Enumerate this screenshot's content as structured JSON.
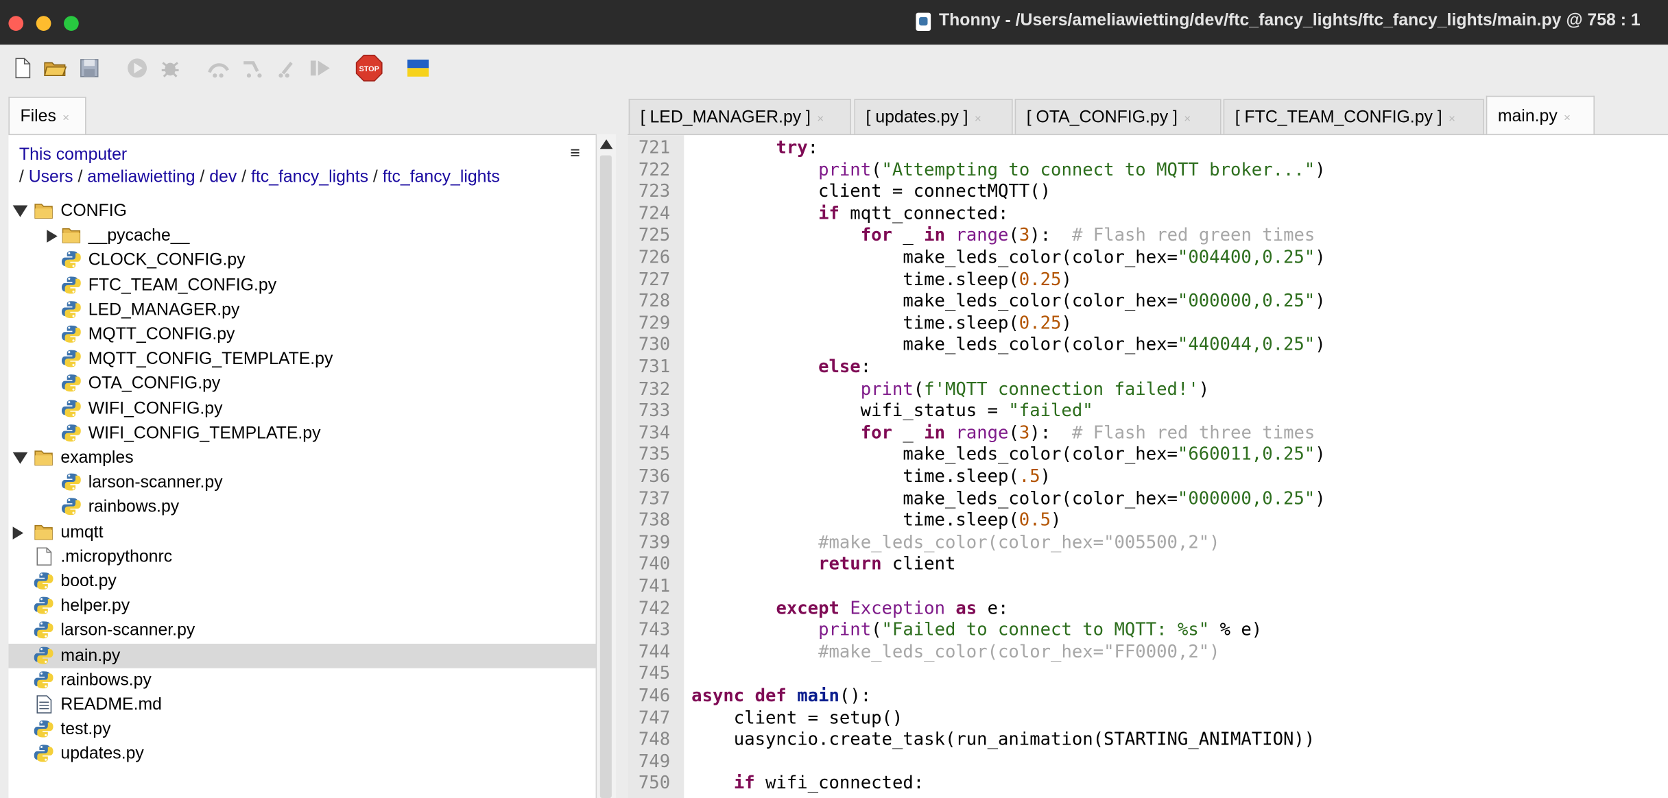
{
  "window": {
    "app_name": "Thonny",
    "title_sep": " - ",
    "path": "/Users/ameliawietting/dev/ftc_fancy_lights/ftc_fancy_lights/main.py",
    "cursor": "@ 758 : 1"
  },
  "toolbar": {
    "buttons": [
      "new-file",
      "open-file",
      "save-file",
      "run",
      "debug",
      "step-over",
      "step-into",
      "step-out",
      "resume",
      "stop",
      "flag"
    ],
    "stop_label": "STOP"
  },
  "files_panel": {
    "tab_label": "Files",
    "tab_close": "×",
    "location_label": "This computer",
    "menu_glyph": "≡",
    "breadcrumb": [
      "Users",
      "ameliawietting",
      "dev",
      "ftc_fancy_lights",
      "ftc_fancy_lights"
    ],
    "breadcrumb_sep": "/",
    "tree": [
      {
        "label": "CONFIG",
        "type": "folder",
        "state": "expanded"
      },
      {
        "label": "__pycache__",
        "type": "folder",
        "state": "collapsed"
      },
      {
        "label": "CLOCK_CONFIG.py",
        "type": "python"
      },
      {
        "label": "FTC_TEAM_CONFIG.py",
        "type": "python"
      },
      {
        "label": "LED_MANAGER.py",
        "type": "python"
      },
      {
        "label": "MQTT_CONFIG.py",
        "type": "python"
      },
      {
        "label": "MQTT_CONFIG_TEMPLATE.py",
        "type": "python"
      },
      {
        "label": "OTA_CONFIG.py",
        "type": "python"
      },
      {
        "label": "WIFI_CONFIG.py",
        "type": "python"
      },
      {
        "label": "WIFI_CONFIG_TEMPLATE.py",
        "type": "python"
      },
      {
        "label": "examples",
        "type": "folder",
        "state": "expanded"
      },
      {
        "label": "larson-scanner.py",
        "type": "python"
      },
      {
        "label": "rainbows.py",
        "type": "python"
      },
      {
        "label": "umqtt",
        "type": "folder",
        "state": "collapsed"
      },
      {
        "label": ".micropythonrc",
        "type": "file"
      },
      {
        "label": "boot.py",
        "type": "python"
      },
      {
        "label": "helper.py",
        "type": "python"
      },
      {
        "label": "larson-scanner.py",
        "type": "python"
      },
      {
        "label": "main.py",
        "type": "python",
        "selected": true
      },
      {
        "label": "rainbows.py",
        "type": "python"
      },
      {
        "label": "README.md",
        "type": "markdown"
      },
      {
        "label": "test.py",
        "type": "python"
      },
      {
        "label": "updates.py",
        "type": "python"
      }
    ]
  },
  "editor_tabs": [
    {
      "label": "[ LED_MANAGER.py ]",
      "close": "×"
    },
    {
      "label": "[ updates.py ]",
      "close": "×"
    },
    {
      "label": "[ OTA_CONFIG.py ]",
      "close": "×"
    },
    {
      "label": "[ FTC_TEAM_CONFIG.py ]",
      "close": "×"
    },
    {
      "label": "main.py",
      "close": "×",
      "active": true
    }
  ],
  "editor": {
    "lines": [
      {
        "n": "721",
        "tokens": [
          [
            "",
            "        "
          ],
          [
            "kw",
            "try"
          ],
          [
            "",
            ":"
          ]
        ]
      },
      {
        "n": "722",
        "tokens": [
          [
            "",
            "            "
          ],
          [
            "bi",
            "print"
          ],
          [
            "",
            "("
          ],
          [
            "st",
            "\"Attempting to connect to MQTT broker...\""
          ],
          [
            "",
            ")"
          ]
        ]
      },
      {
        "n": "723",
        "tokens": [
          [
            "",
            "            client = connectMQTT()"
          ]
        ]
      },
      {
        "n": "724",
        "tokens": [
          [
            "",
            "            "
          ],
          [
            "kw",
            "if"
          ],
          [
            "",
            " mqtt_connected:"
          ]
        ]
      },
      {
        "n": "725",
        "tokens": [
          [
            "",
            "                "
          ],
          [
            "kw",
            "for"
          ],
          [
            "",
            " _ "
          ],
          [
            "kw",
            "in"
          ],
          [
            "",
            " "
          ],
          [
            "bi",
            "range"
          ],
          [
            "",
            "("
          ],
          [
            "nu",
            "3"
          ],
          [
            "",
            "):  "
          ],
          [
            "cm",
            "# Flash red green times"
          ]
        ]
      },
      {
        "n": "726",
        "tokens": [
          [
            "",
            "                    make_leds_color(color_hex="
          ],
          [
            "st",
            "\"004400,0.25\""
          ],
          [
            "",
            ")"
          ]
        ]
      },
      {
        "n": "727",
        "tokens": [
          [
            "",
            "                    time.sleep("
          ],
          [
            "nu",
            "0.25"
          ],
          [
            "",
            ")"
          ]
        ]
      },
      {
        "n": "728",
        "tokens": [
          [
            "",
            "                    make_leds_color(color_hex="
          ],
          [
            "st",
            "\"000000,0.25\""
          ],
          [
            "",
            ")"
          ]
        ]
      },
      {
        "n": "729",
        "tokens": [
          [
            "",
            "                    time.sleep("
          ],
          [
            "nu",
            "0.25"
          ],
          [
            "",
            ")"
          ]
        ]
      },
      {
        "n": "730",
        "tokens": [
          [
            "",
            "                    make_leds_color(color_hex="
          ],
          [
            "st",
            "\"440044,0.25\""
          ],
          [
            "",
            ")"
          ]
        ]
      },
      {
        "n": "731",
        "tokens": [
          [
            "",
            "            "
          ],
          [
            "kw",
            "else"
          ],
          [
            "",
            ":"
          ]
        ]
      },
      {
        "n": "732",
        "tokens": [
          [
            "",
            "                "
          ],
          [
            "bi",
            "print"
          ],
          [
            "",
            "("
          ],
          [
            "st",
            "f'MQTT connection failed!'"
          ],
          [
            "",
            ")"
          ]
        ]
      },
      {
        "n": "733",
        "tokens": [
          [
            "",
            "                wifi_status = "
          ],
          [
            "st",
            "\"failed\""
          ]
        ]
      },
      {
        "n": "734",
        "tokens": [
          [
            "",
            "                "
          ],
          [
            "kw",
            "for"
          ],
          [
            "",
            " _ "
          ],
          [
            "kw",
            "in"
          ],
          [
            "",
            " "
          ],
          [
            "bi",
            "range"
          ],
          [
            "",
            "("
          ],
          [
            "nu",
            "3"
          ],
          [
            "",
            "):  "
          ],
          [
            "cm",
            "# Flash red three times"
          ]
        ]
      },
      {
        "n": "735",
        "tokens": [
          [
            "",
            "                    make_leds_color(color_hex="
          ],
          [
            "st",
            "\"660011,0.25\""
          ],
          [
            "",
            ")"
          ]
        ]
      },
      {
        "n": "736",
        "tokens": [
          [
            "",
            "                    time.sleep("
          ],
          [
            "nu",
            ".5"
          ],
          [
            "",
            ")"
          ]
        ]
      },
      {
        "n": "737",
        "tokens": [
          [
            "",
            "                    make_leds_color(color_hex="
          ],
          [
            "st",
            "\"000000,0.25\""
          ],
          [
            "",
            ")"
          ]
        ]
      },
      {
        "n": "738",
        "tokens": [
          [
            "",
            "                    time.sleep("
          ],
          [
            "nu",
            "0.5"
          ],
          [
            "",
            ")"
          ]
        ]
      },
      {
        "n": "739",
        "tokens": [
          [
            "",
            "            "
          ],
          [
            "cm",
            "#make_leds_color(color_hex=\"005500,2\")"
          ]
        ]
      },
      {
        "n": "740",
        "tokens": [
          [
            "",
            "            "
          ],
          [
            "kw",
            "return"
          ],
          [
            "",
            " client"
          ]
        ]
      },
      {
        "n": "741",
        "tokens": [
          [
            "",
            ""
          ]
        ]
      },
      {
        "n": "742",
        "tokens": [
          [
            "",
            "        "
          ],
          [
            "kw",
            "except"
          ],
          [
            "",
            " "
          ],
          [
            "bi",
            "Exception"
          ],
          [
            "",
            " "
          ],
          [
            "kw",
            "as"
          ],
          [
            "",
            " e:"
          ]
        ]
      },
      {
        "n": "743",
        "tokens": [
          [
            "",
            "            "
          ],
          [
            "bi",
            "print"
          ],
          [
            "",
            "("
          ],
          [
            "st",
            "\"Failed to connect to MQTT: %s\""
          ],
          [
            "",
            " % e)"
          ]
        ]
      },
      {
        "n": "744",
        "tokens": [
          [
            "",
            "            "
          ],
          [
            "cm",
            "#make_leds_color(color_hex=\"FF0000,2\")"
          ]
        ]
      },
      {
        "n": "745",
        "tokens": [
          [
            "",
            ""
          ]
        ]
      },
      {
        "n": "746",
        "tokens": [
          [
            "kw",
            "async"
          ],
          [
            "",
            " "
          ],
          [
            "kw",
            "def"
          ],
          [
            "",
            " "
          ],
          [
            "fn",
            "main"
          ],
          [
            "",
            "():"
          ]
        ]
      },
      {
        "n": "747",
        "tokens": [
          [
            "",
            "    client = setup()"
          ]
        ]
      },
      {
        "n": "748",
        "tokens": [
          [
            "",
            "    uasyncio.create_task(run_animation(STARTING_ANIMATION))"
          ]
        ]
      },
      {
        "n": "749",
        "tokens": [
          [
            "",
            ""
          ]
        ]
      },
      {
        "n": "750",
        "tokens": [
          [
            "",
            "    "
          ],
          [
            "kw",
            "if"
          ],
          [
            "",
            " wifi_connected:"
          ]
        ]
      }
    ]
  },
  "colors": {
    "titlebar": "#2b2b2b",
    "keyword": "#7f0b55",
    "builtin": "#7f1b8a",
    "string": "#2d6e1d",
    "number": "#b35400",
    "comment": "#a7a7a7",
    "breadcrumb_link": "#1a0aa0",
    "selection": "#d9d9d9"
  }
}
